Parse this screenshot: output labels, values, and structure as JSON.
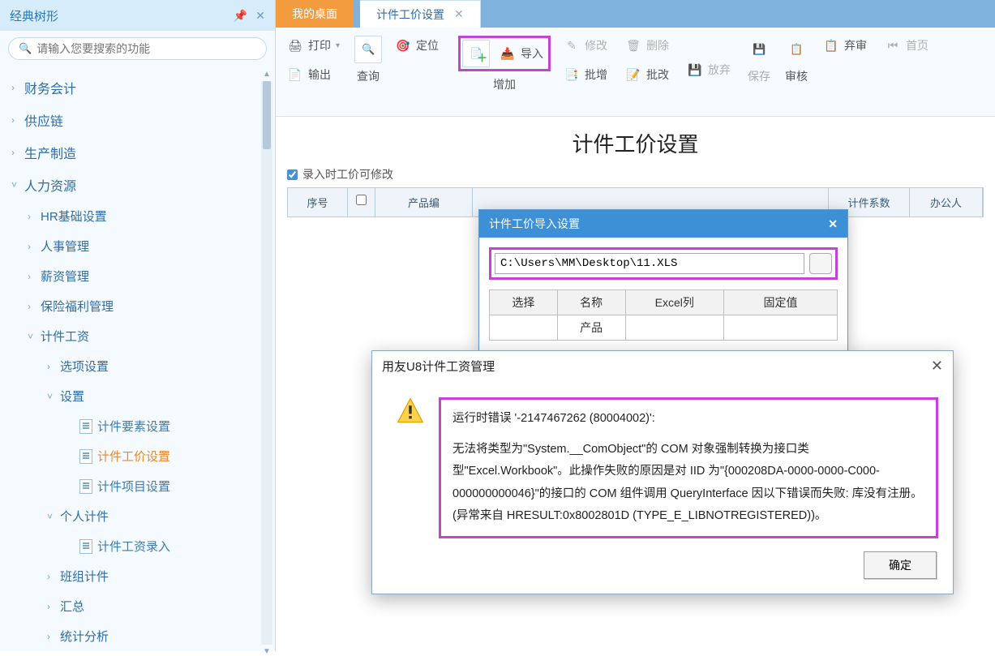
{
  "sidebar": {
    "title": "经典树形",
    "search_placeholder": "请输入您要搜索的功能",
    "items": [
      {
        "label": "财务会计",
        "level": 1,
        "caret": "›"
      },
      {
        "label": "供应链",
        "level": 1,
        "caret": "›"
      },
      {
        "label": "生产制造",
        "level": 1,
        "caret": "›"
      },
      {
        "label": "人力资源",
        "level": 1,
        "caret": "˅"
      },
      {
        "label": "HR基础设置",
        "level": 2,
        "caret": "›"
      },
      {
        "label": "人事管理",
        "level": 2,
        "caret": "›"
      },
      {
        "label": "薪资管理",
        "level": 2,
        "caret": "›"
      },
      {
        "label": "保险福利管理",
        "level": 2,
        "caret": "›"
      },
      {
        "label": "计件工资",
        "level": 2,
        "caret": "˅"
      },
      {
        "label": "选项设置",
        "level": 3,
        "caret": "›"
      },
      {
        "label": "设置",
        "level": 3,
        "caret": "˅"
      },
      {
        "label": "计件要素设置",
        "level": 4,
        "leaf": true
      },
      {
        "label": "计件工价设置",
        "level": 4,
        "leaf": true,
        "selected": true
      },
      {
        "label": "计件项目设置",
        "level": 4,
        "leaf": true
      },
      {
        "label": "个人计件",
        "level": 3,
        "caret": "˅"
      },
      {
        "label": "计件工资录入",
        "level": 4,
        "leaf": true
      },
      {
        "label": "班组计件",
        "level": 3,
        "caret": "›"
      },
      {
        "label": "汇总",
        "level": 3,
        "caret": "›"
      },
      {
        "label": "统计分析",
        "level": 3,
        "caret": "›"
      }
    ]
  },
  "tabs": {
    "inactive": "我的桌面",
    "active": "计件工价设置"
  },
  "toolbar": {
    "print": "打印",
    "export": "输出",
    "query": "查询",
    "locate": "定位",
    "add": "增加",
    "import": "导入",
    "modify": "修改",
    "batch_add": "批增",
    "delete": "删除",
    "batch_modify": "批改",
    "release": "放弃",
    "save": "保存",
    "audit": "审核",
    "abandon": "弃审",
    "home": "首页"
  },
  "page": {
    "title": "计件工价设置",
    "checkbox_label": "录入时工价可修改",
    "columns": {
      "seq": "序号",
      "product": "产品编",
      "coef": "计件系数",
      "office": "办公人"
    }
  },
  "import_dialog": {
    "title": "计件工价导入设置",
    "path": "C:\\Users\\MM\\Desktop\\11.XLS",
    "headers": {
      "select": "选择",
      "name": "名称",
      "excel": "Excel列",
      "fixed": "固定值"
    },
    "row_name": "产品"
  },
  "error_dialog": {
    "title": "用友U8计件工资管理",
    "line1": "运行时错误 '-2147467262 (80004002)':",
    "line2": "无法将类型为\"System.__ComObject\"的 COM 对象强制转换为接口类型\"Excel.Workbook\"。此操作失败的原因是对 IID 为\"{000208DA-0000-0000-C000-000000000046}\"的接口的 COM 组件调用 QueryInterface 因以下错误而失败: 库没有注册。 (异常来自 HRESULT:0x8002801D (TYPE_E_LIBNOTREGISTERED))。",
    "ok": "确定"
  }
}
